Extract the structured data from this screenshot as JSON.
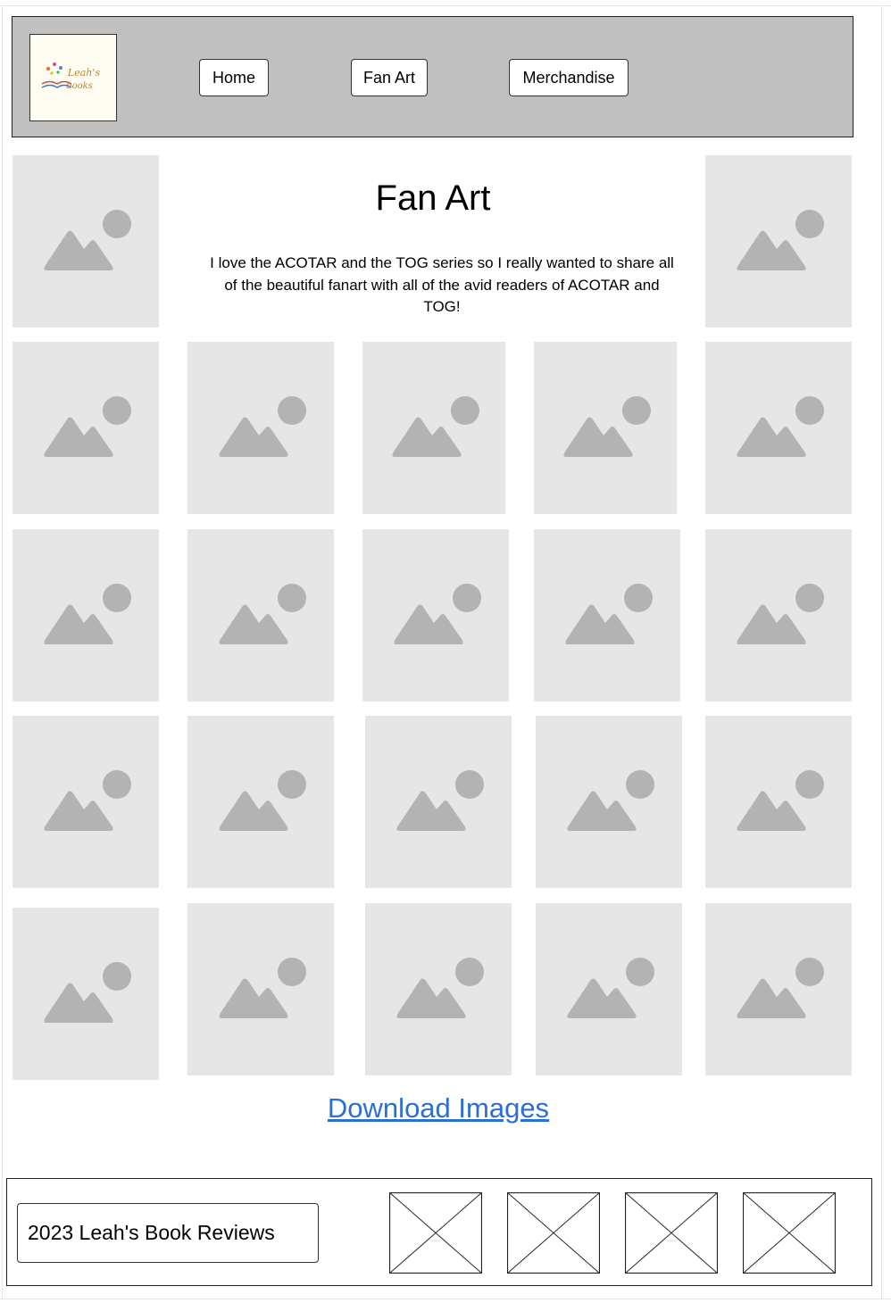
{
  "header": {
    "logo_text_line1": "Leah's",
    "logo_text_line2": "books",
    "nav": [
      {
        "label": "Home"
      },
      {
        "label": "Fan Art"
      },
      {
        "label": "Merchandise"
      }
    ]
  },
  "main": {
    "title": "Fan Art",
    "description": "I love the ACOTAR and the TOG series so I really wanted to share all of the beautiful fanart with all of the avid readers of ACOTAR and TOG!",
    "gallery_icon": "image-placeholder-icon",
    "download_link": "Download Images"
  },
  "footer": {
    "copyright": "2023 Leah's Book Reviews",
    "social_placeholders": [
      "image-placeholder-x",
      "image-placeholder-x",
      "image-placeholder-x",
      "image-placeholder-x"
    ]
  },
  "colors": {
    "header_bg": "#c0c0c0",
    "placeholder_bg": "#e6e6e6",
    "placeholder_icon": "#b3b3b3",
    "link": "#2a6fd6"
  }
}
